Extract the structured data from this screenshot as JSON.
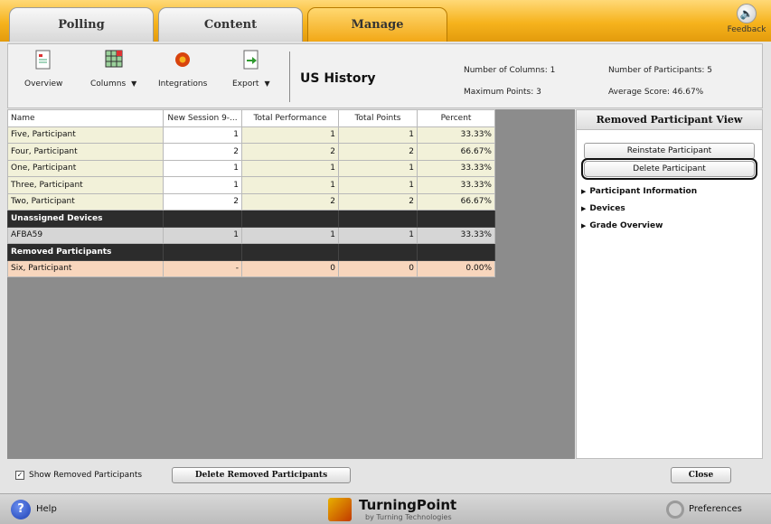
{
  "tabs": [
    {
      "label": "Polling"
    },
    {
      "label": "Content"
    },
    {
      "label": "Manage"
    }
  ],
  "active_tab": "Manage",
  "feedback": {
    "label": "Feedback"
  },
  "toolbar": {
    "overview": "Overview",
    "columns": "Columns",
    "integrations": "Integrations",
    "export": "Export",
    "course_title": "US History",
    "num_columns": "Number of Columns: 1",
    "max_points": "Maximum Points: 3",
    "num_participants": "Number of Participants: 5",
    "avg_score": "Average Score: 46.67%"
  },
  "table": {
    "headers": [
      "Name",
      "New Session 9-...",
      "Total Performance",
      "Total Points",
      "Percent"
    ],
    "active_rows": [
      [
        "Five, Participant",
        "1",
        "1",
        "1",
        "33.33%"
      ],
      [
        "Four, Participant",
        "2",
        "2",
        "2",
        "66.67%"
      ],
      [
        "One, Participant",
        "1",
        "1",
        "1",
        "33.33%"
      ],
      [
        "Three, Participant",
        "1",
        "1",
        "1",
        "33.33%"
      ],
      [
        "Two, Participant",
        "2",
        "2",
        "2",
        "66.67%"
      ]
    ],
    "unassigned_label": "Unassigned Devices",
    "device_row": [
      "AFBA59",
      "1",
      "1",
      "1",
      "33.33%"
    ],
    "removed_label": "Removed Participants",
    "removed_row": [
      "Six, Participant",
      "-",
      "0",
      "0",
      "0.00%"
    ]
  },
  "right_panel": {
    "title": "Removed Participant View",
    "reinstate": "Reinstate Participant",
    "delete": "Delete Participant",
    "sections": [
      "Participant Information",
      "Devices",
      "Grade Overview"
    ]
  },
  "bottom": {
    "show_removed": "Show Removed Participants",
    "show_removed_checked": true,
    "delete_removed": "Delete Removed Participants",
    "close": "Close"
  },
  "footer": {
    "help": "Help",
    "brand_name": "TurningPoint",
    "brand_sub": "by Turning Technologies",
    "preferences": "Preferences"
  },
  "colors": {
    "tab_bar": "#f6b31d",
    "active_row": "#f2f1d9",
    "group_row": "#2c2c2c",
    "removed_row": "#f8d6bd"
  }
}
